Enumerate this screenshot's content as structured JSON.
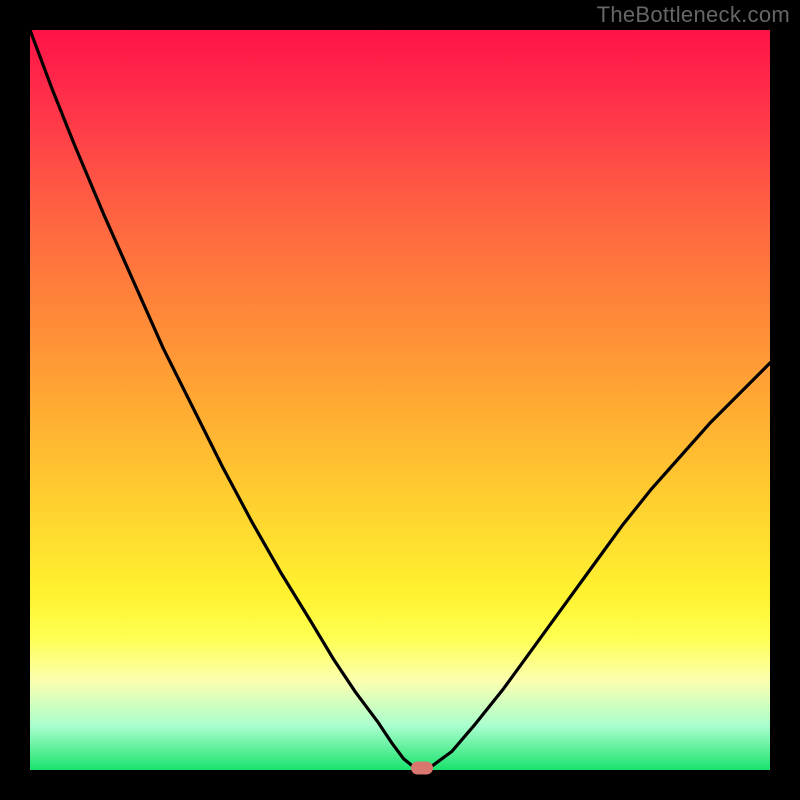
{
  "watermark": "TheBottleneck.com",
  "chart_data": {
    "type": "line",
    "title": "",
    "xlabel": "",
    "ylabel": "",
    "xlim": [
      0,
      100
    ],
    "ylim": [
      0,
      100
    ],
    "grid": false,
    "legend": false,
    "series": [
      {
        "name": "bottleneck-curve",
        "x": [
          0,
          3,
          6,
          10,
          14,
          18,
          22,
          26,
          30,
          34,
          38,
          41,
          44,
          47,
          49,
          50.5,
          52,
          54,
          57,
          60,
          64,
          68,
          72,
          76,
          80,
          84,
          88,
          92,
          96,
          100
        ],
        "y": [
          100,
          92,
          84.5,
          75,
          66,
          57,
          49,
          41,
          33.5,
          26.5,
          20,
          15,
          10.5,
          6.5,
          3.5,
          1.5,
          0.3,
          0.3,
          2.5,
          6,
          11,
          16.5,
          22,
          27.5,
          33,
          38,
          42.5,
          47,
          51,
          55
        ]
      }
    ],
    "annotations": [
      {
        "name": "minimum-marker",
        "x": 53,
        "y": 0.3
      }
    ],
    "background_gradient": {
      "stops": [
        {
          "pos": 0,
          "color": "#ff1347"
        },
        {
          "pos": 8,
          "color": "#ff2b4a"
        },
        {
          "pos": 22,
          "color": "#ff5a44"
        },
        {
          "pos": 35,
          "color": "#ff7f3b"
        },
        {
          "pos": 50,
          "color": "#ffa833"
        },
        {
          "pos": 65,
          "color": "#ffd32f"
        },
        {
          "pos": 76,
          "color": "#fff22f"
        },
        {
          "pos": 82,
          "color": "#ffff50"
        },
        {
          "pos": 88,
          "color": "#fbffb0"
        },
        {
          "pos": 94,
          "color": "#aaffce"
        },
        {
          "pos": 100,
          "color": "#19e26d"
        }
      ]
    }
  },
  "colors": {
    "curve": "#000000",
    "marker": "#d8766f",
    "frame": "#000000"
  }
}
